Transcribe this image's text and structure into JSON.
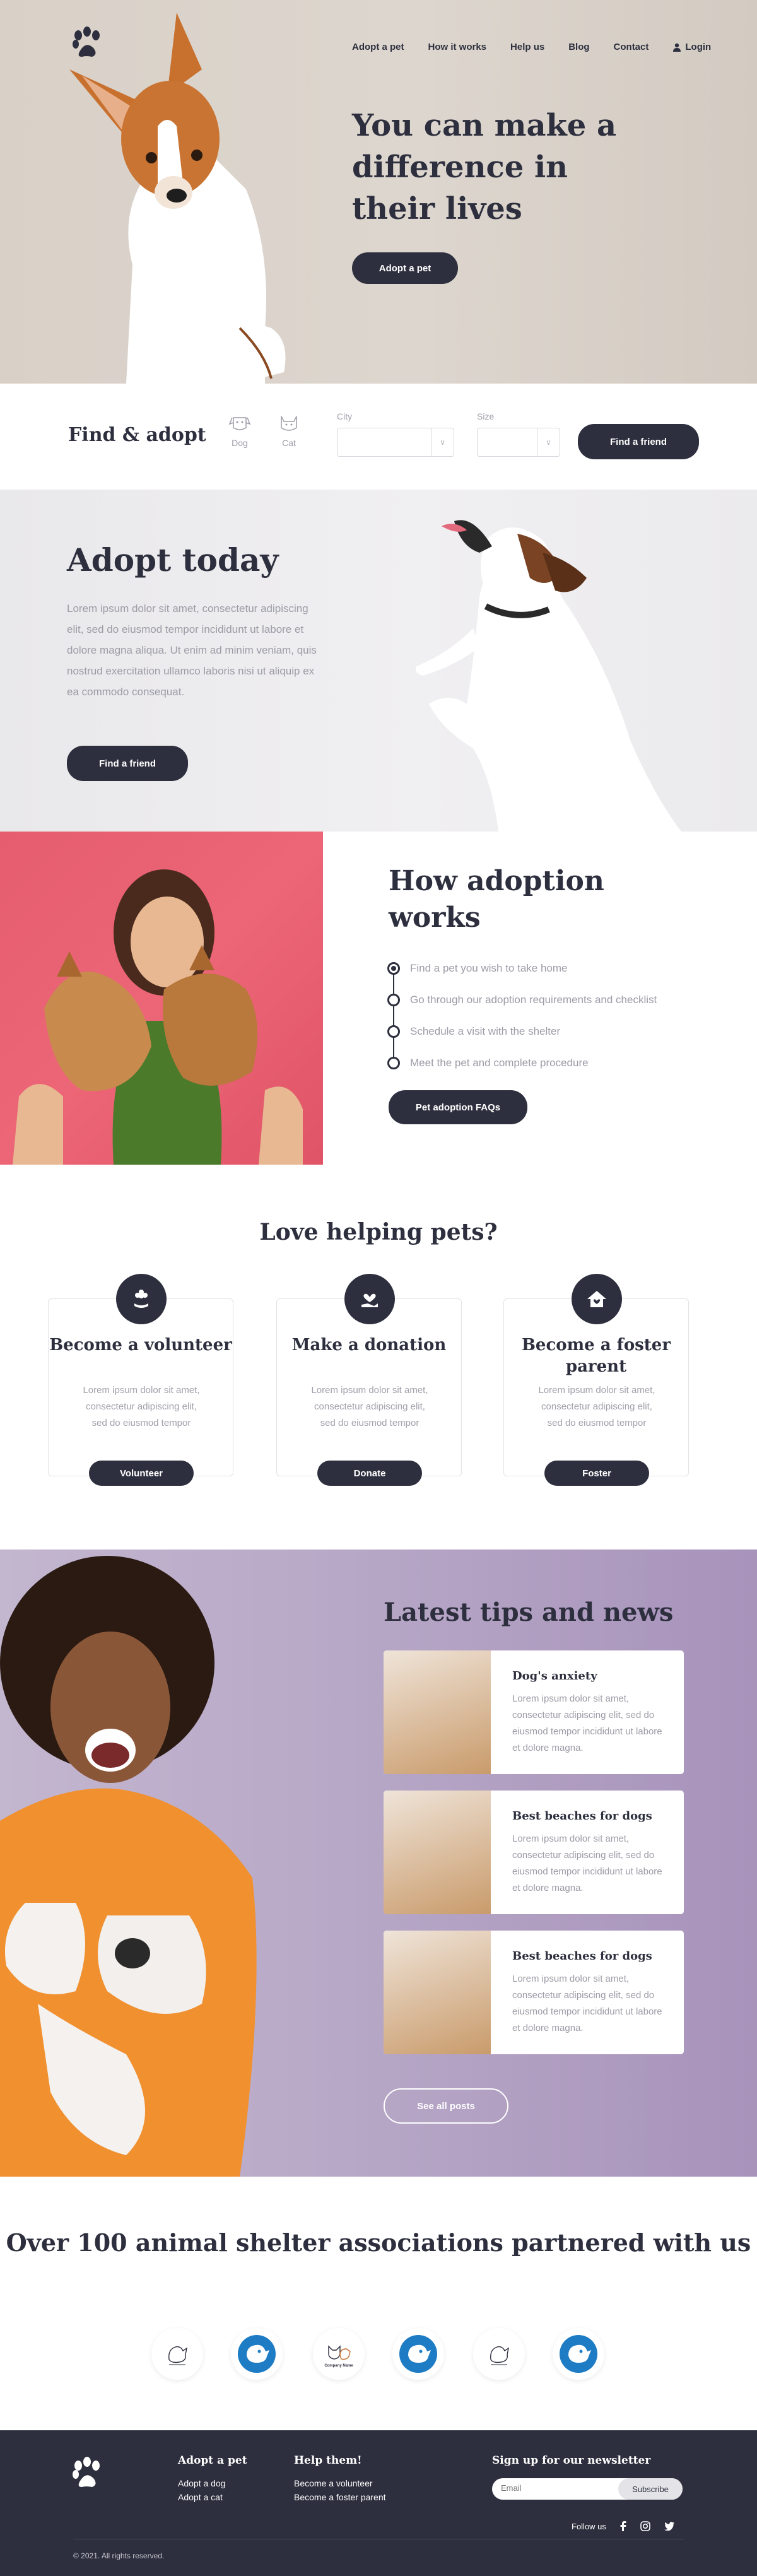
{
  "nav": {
    "items": [
      "Adopt a pet",
      "How it works",
      "Help us",
      "Blog",
      "Contact"
    ],
    "login": "Login"
  },
  "hero": {
    "title": "You can make a difference in their lives",
    "button": "Adopt a pet"
  },
  "find": {
    "title": "Find & adopt",
    "types": [
      "Dog",
      "Cat"
    ],
    "city_label": "City",
    "city_value": "",
    "size_label": "Size",
    "size_value": "",
    "button": "Find a friend"
  },
  "adopt": {
    "title": "Adopt today",
    "text": "Lorem ipsum dolor sit amet, consectetur adipiscing elit, sed do eiusmod tempor incididunt ut labore et dolore magna aliqua. Ut enim ad minim veniam, quis nostrud exercitation ullamco laboris nisi ut aliquip ex ea commodo consequat.",
    "button": "Find a friend"
  },
  "how": {
    "title": "How adoption works",
    "steps": [
      "Find a pet you wish to take home",
      "Go through our adoption requirements and checklist",
      "Schedule a visit with the shelter",
      "Meet the pet and complete procedure"
    ],
    "active_step": 1,
    "button": "Pet adoption FAQs"
  },
  "help": {
    "title": "Love helping pets?",
    "cards": [
      {
        "title": "Become a volunteer",
        "text": "Lorem ipsum dolor sit amet, consectetur adipiscing elit, sed do eiusmod tempor",
        "button": "Volunteer",
        "icon": "flower-hand-icon"
      },
      {
        "title": "Make a donation",
        "text": "Lorem ipsum dolor sit amet, consectetur adipiscing elit, sed do eiusmod tempor",
        "button": "Donate",
        "icon": "heart-hand-icon"
      },
      {
        "title": "Become a foster parent",
        "text": "Lorem ipsum dolor sit amet, consectetur adipiscing elit, sed do eiusmod tempor",
        "button": "Foster",
        "icon": "home-heart-icon"
      }
    ]
  },
  "news": {
    "title": "Latest tips and news",
    "posts": [
      {
        "title": "Dog's anxiety",
        "text": "Lorem ipsum dolor sit amet, consectetur adipiscing elit, sed do eiusmod tempor incididunt ut labore et dolore magna."
      },
      {
        "title": "Best beaches for dogs",
        "text": "Lorem ipsum dolor sit amet, consectetur adipiscing elit, sed do eiusmod tempor incididunt ut labore et dolore magna."
      },
      {
        "title": "Best beaches for dogs",
        "text": "Lorem ipsum dolor sit amet, consectetur adipiscing elit, sed do eiusmod tempor incididunt ut labore et dolore magna."
      }
    ],
    "button": "See all posts"
  },
  "partners": {
    "title": "Over 100 animal shelter associations partnered with us",
    "logo_caption": "Company Name"
  },
  "footer": {
    "col1": {
      "title": "Adopt a pet",
      "links": [
        "Adopt a dog",
        "Adopt a cat"
      ]
    },
    "col2": {
      "title": "Help them!",
      "links": [
        "Become a volunteer",
        "Become a foster parent"
      ]
    },
    "newsletter": {
      "title": "Sign up for our newsletter",
      "placeholder": "Email",
      "button": "Subscribe"
    },
    "follow": "Follow us",
    "copyright": "© 2021. All rights reserved."
  },
  "colors": {
    "dark": "#2d2f3e",
    "muted": "#9c9ca7",
    "pink": "#ec6677",
    "lavender": "#b9aac8",
    "partner_blue": "#1e7cc4"
  }
}
